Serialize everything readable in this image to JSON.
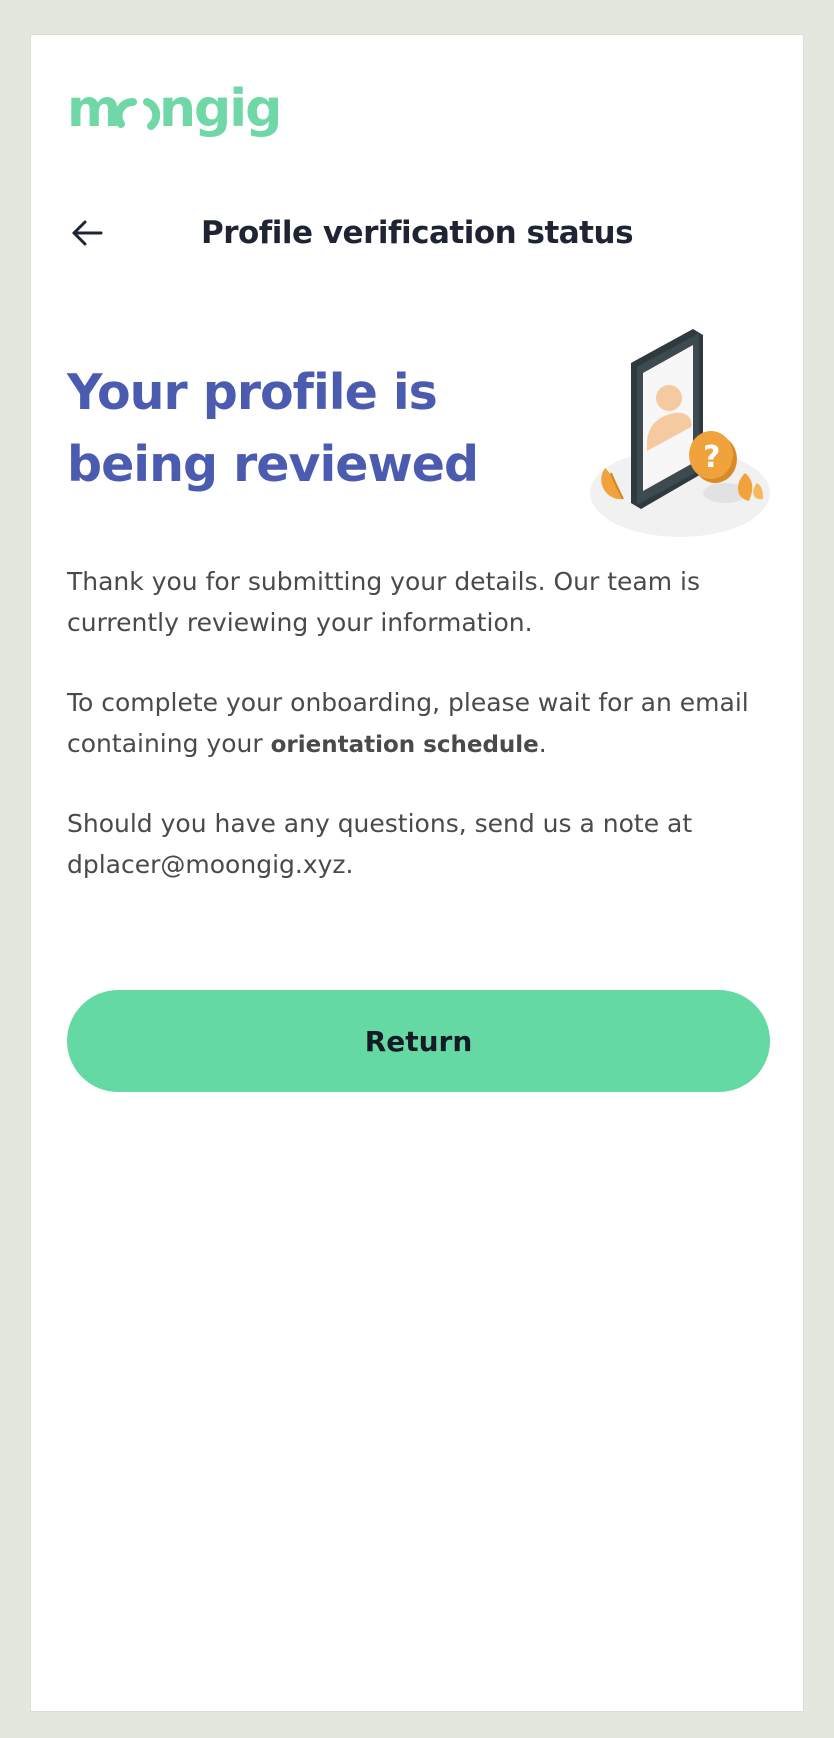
{
  "brand": {
    "logo_text": "moongig",
    "logo_color": "#6fd8a6"
  },
  "header": {
    "back_icon": "arrow-left-icon",
    "title": "Profile verification status"
  },
  "hero": {
    "title_line1": "Your profile is",
    "title_line2": "being reviewed",
    "title_color": "#4b5bb0",
    "illustration": "phone-profile-question-illustration"
  },
  "body": {
    "paragraph1": "Thank you for submitting your details. Our team is currently reviewing your information.",
    "paragraph2_prefix": "To complete your onboarding, please wait for an email containing your ",
    "paragraph2_bold": "orientation schedule",
    "paragraph2_suffix": ".",
    "paragraph3": "Should you have any questions, send us a note at dplacer@moongig.xyz."
  },
  "actions": {
    "return_label": "Return",
    "return_color": "#64d9a3"
  }
}
